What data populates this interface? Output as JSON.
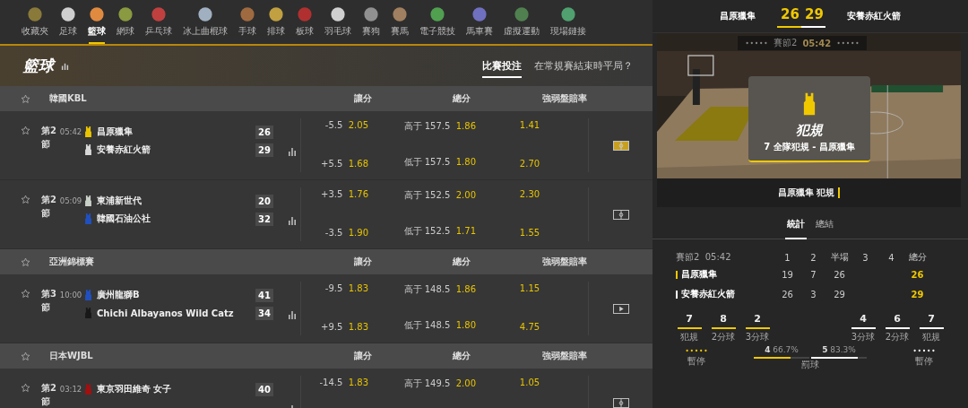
{
  "sports_nav": [
    {
      "label": "收藏夾",
      "selected": false
    },
    {
      "label": "足球",
      "selected": false
    },
    {
      "label": "籃球",
      "selected": true
    },
    {
      "label": "網球",
      "selected": false
    },
    {
      "label": "乒乓球",
      "selected": false
    },
    {
      "label": "冰上曲棍球",
      "selected": false
    },
    {
      "label": "手球",
      "selected": false
    },
    {
      "label": "排球",
      "selected": false
    },
    {
      "label": "板球",
      "selected": false
    },
    {
      "label": "羽毛球",
      "selected": false
    },
    {
      "label": "賽狗",
      "selected": false
    },
    {
      "label": "賽馬",
      "selected": false
    },
    {
      "label": "電子競技",
      "selected": false
    },
    {
      "label": "馬車賽",
      "selected": false
    },
    {
      "label": "虛擬運動",
      "selected": false
    },
    {
      "label": "現場鏈接",
      "selected": false
    }
  ],
  "section": {
    "title": "籃球",
    "tabs": [
      {
        "label": "比賽投注",
        "selected": true
      },
      {
        "label": "在常規賽結束時平局？",
        "selected": false
      }
    ]
  },
  "leagues": [
    {
      "name": "韓國KBL",
      "columns": [
        "讓分",
        "總分",
        "強弱盤賠率"
      ],
      "matches": [
        {
          "period": "第2節",
          "time": "05:42",
          "teams": [
            {
              "name": "昌原獵隼",
              "score": "26",
              "color": "#e8c400"
            },
            {
              "name": "安養赤紅火箭",
              "score": "29",
              "color": "#d8d8d8"
            }
          ],
          "handicap": [
            {
              "line": "-5.5",
              "odds": "2.05"
            },
            {
              "line": "+5.5",
              "odds": "1.68"
            }
          ],
          "total": [
            {
              "line": "高于 157.5",
              "odds": "1.86"
            },
            {
              "line": "低于 157.5",
              "odds": "1.80"
            }
          ],
          "moneyline": [
            "1.41",
            "2.70"
          ],
          "media": {
            "kind": "court",
            "active": true
          }
        },
        {
          "period": "第2節",
          "time": "05:09",
          "teams": [
            {
              "name": "東浦新世代",
              "score": "20",
              "color": "#c8d0c8"
            },
            {
              "name": "韓國石油公社",
              "score": "32",
              "color": "#2050c0"
            }
          ],
          "handicap": [
            {
              "line": "+3.5",
              "odds": "1.76"
            },
            {
              "line": "-3.5",
              "odds": "1.90"
            }
          ],
          "total": [
            {
              "line": "高于 152.5",
              "odds": "2.00"
            },
            {
              "line": "低于 152.5",
              "odds": "1.71"
            }
          ],
          "moneyline": [
            "2.30",
            "1.55"
          ],
          "media": {
            "kind": "court",
            "active": false
          }
        }
      ]
    },
    {
      "name": "亞洲錦標賽",
      "columns": [
        "讓分",
        "總分",
        "強弱盤賠率"
      ],
      "matches": [
        {
          "period": "第3節",
          "time": "10:00",
          "teams": [
            {
              "name": "廣州龍獅B",
              "score": "41",
              "color": "#2050c0"
            },
            {
              "name": "Chichi Albayanos Wild Catz",
              "score": "34",
              "color": "#181818"
            }
          ],
          "handicap": [
            {
              "line": "-9.5",
              "odds": "1.83"
            },
            {
              "line": "+9.5",
              "odds": "1.83"
            }
          ],
          "total": [
            {
              "line": "高于 148.5",
              "odds": "1.86"
            },
            {
              "line": "低于 148.5",
              "odds": "1.80"
            }
          ],
          "moneyline": [
            "1.15",
            "4.75"
          ],
          "media": {
            "kind": "video",
            "active": false
          }
        }
      ]
    },
    {
      "name": "日本WJBL",
      "columns": [
        "讓分",
        "總分",
        "強弱盤賠率"
      ],
      "matches": [
        {
          "period": "第2節",
          "time": "03:12",
          "teams": [
            {
              "name": "東京羽田維奇 女子",
              "score": "40",
              "color": "#a01010"
            }
          ],
          "handicap": [
            {
              "line": "-14.5",
              "odds": "1.83"
            }
          ],
          "total": [
            {
              "line": "高于 149.5",
              "odds": "2.00"
            }
          ],
          "moneyline": [
            "1.05"
          ],
          "media": {
            "kind": "court",
            "active": false
          }
        }
      ]
    }
  ],
  "live": {
    "home": {
      "name": "昌原獵隼",
      "score": "26",
      "color": "#f0c800"
    },
    "away": {
      "name": "安養赤紅火箭",
      "score": "29",
      "color": "#ffffff"
    },
    "clock": {
      "period": "賽節2",
      "time": "05:42"
    },
    "event": {
      "title": "犯規",
      "detail": "7 全隊犯規 - 昌原獵隼"
    },
    "ticker": "昌原獵隼 犯規",
    "tabs": [
      {
        "label": "統計",
        "selected": true
      },
      {
        "label": "總結",
        "selected": false
      }
    ],
    "scoreboard": {
      "period": "賽節2",
      "time": "05:42",
      "columns": [
        "1",
        "2",
        "半場",
        "3",
        "4",
        "總分"
      ],
      "rows": [
        {
          "team": "昌原獵隼",
          "color": "#f0c800",
          "cells": [
            "19",
            "7",
            "26",
            "",
            ""
          ],
          "total": "26"
        },
        {
          "team": "安養赤紅火箭",
          "color": "#ffffff",
          "cells": [
            "26",
            "3",
            "29",
            "",
            ""
          ],
          "total": "29"
        }
      ]
    },
    "stats": {
      "home": [
        {
          "value": "7",
          "label": "犯規"
        },
        {
          "value": "8",
          "label": "2分球"
        },
        {
          "value": "2",
          "label": "3分球"
        }
      ],
      "away": [
        {
          "value": "4",
          "label": "3分球"
        },
        {
          "value": "6",
          "label": "2分球"
        },
        {
          "value": "7",
          "label": "犯規"
        }
      ]
    },
    "timeouts": {
      "home_label": "暫停",
      "away_label": "暫停"
    },
    "free_throws": {
      "label": "罰球",
      "home": {
        "value": "4",
        "pct": "66.7%",
        "level": 0.667
      },
      "away": {
        "value": "5",
        "pct": "83.3%",
        "level": 0.833
      }
    }
  }
}
